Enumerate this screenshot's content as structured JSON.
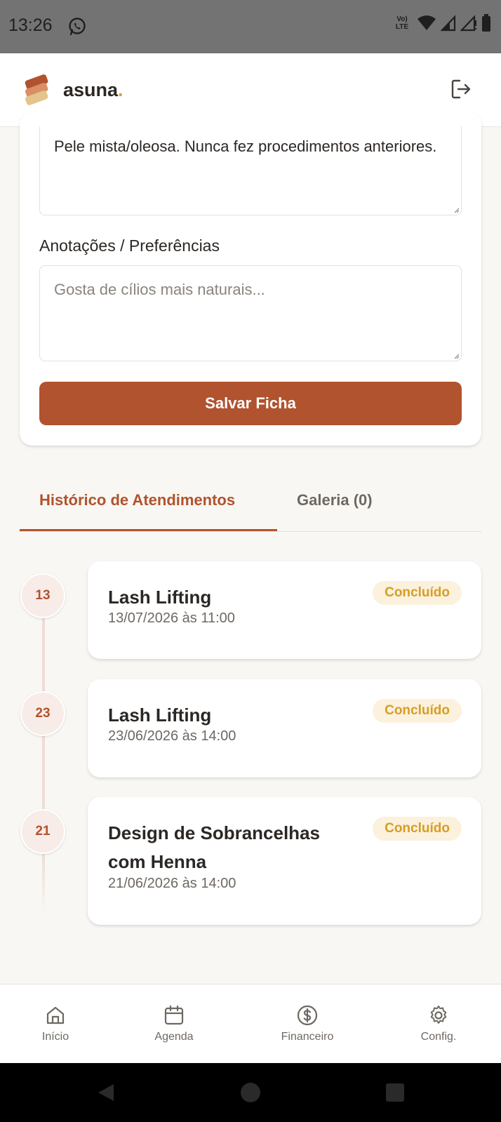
{
  "status_bar": {
    "time": "13:26",
    "network_label": "Vo) LTE",
    "icons": [
      "whatsapp-icon",
      "wifi-icon",
      "signal-icon",
      "signal-no-data-icon",
      "battery-icon"
    ]
  },
  "header": {
    "brand": "asuna",
    "brand_dot": ".",
    "logout_icon": "logout-icon",
    "colors": {
      "brand_dot": "#d9a22a",
      "accent": "#b0532e"
    }
  },
  "form": {
    "observacoes_value": "Pele mista/oleosa. Nunca fez procedimentos anteriores.",
    "anotacoes_label": "Anotações / Preferências",
    "anotacoes_placeholder": "Gosta de cílios mais naturais...",
    "save_label": "Salvar Ficha"
  },
  "tabs": {
    "historico": "Histórico de Atendimentos",
    "galeria": "Galeria (0)",
    "active": "historico"
  },
  "appointments": [
    {
      "day": "13",
      "service": "Lash Lifting",
      "datetime": "13/07/2026 às 11:00",
      "status": "Concluído"
    },
    {
      "day": "23",
      "service": "Lash Lifting",
      "datetime": "23/06/2026 às 14:00",
      "status": "Concluído"
    },
    {
      "day": "21",
      "service": "Design de Sobrancelhas com Henna",
      "datetime": "21/06/2026 às 14:00",
      "status": "Concluído"
    }
  ],
  "bottom_nav": [
    {
      "label": "Início",
      "icon": "home-icon"
    },
    {
      "label": "Agenda",
      "icon": "calendar-icon"
    },
    {
      "label": "Financeiro",
      "icon": "dollar-icon"
    },
    {
      "label": "Config.",
      "icon": "gear-icon"
    }
  ],
  "system_nav": {
    "icons": [
      "back-icon",
      "home-circle-icon",
      "recents-icon"
    ]
  }
}
